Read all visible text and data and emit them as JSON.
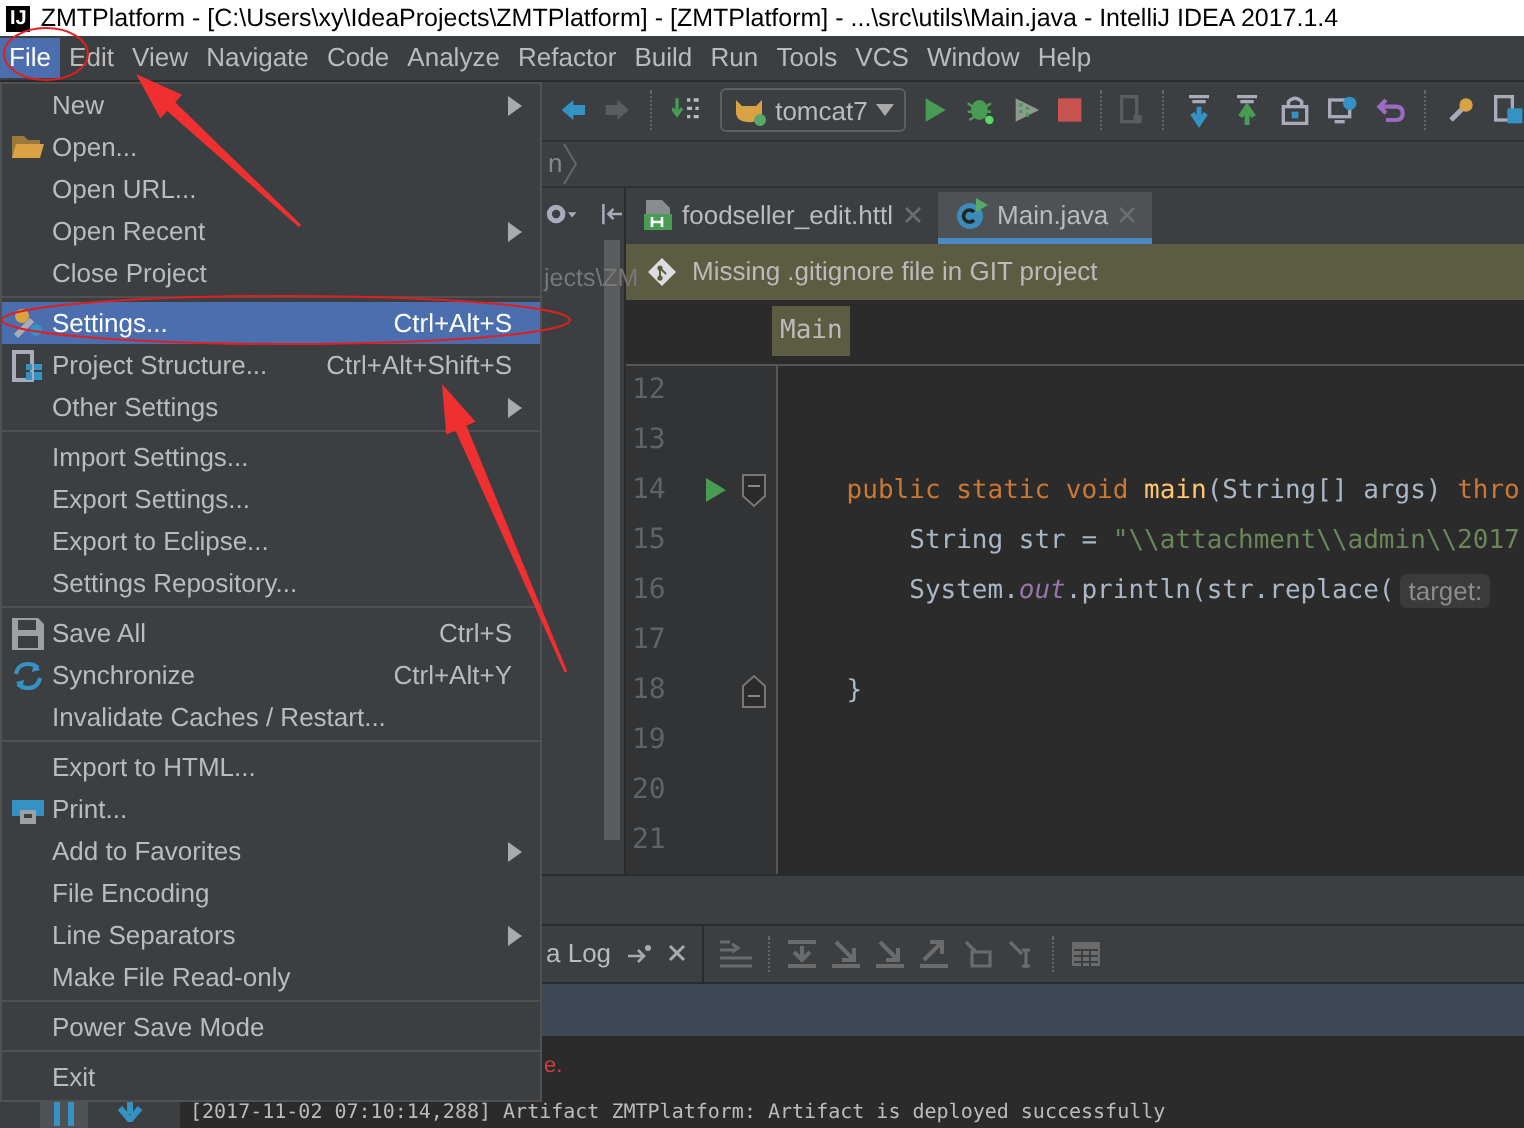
{
  "window": {
    "app_icon": "IJ",
    "title": "ZMTPlatform - [C:\\Users\\xy\\IdeaProjects\\ZMTPlatform] - [ZMTPlatform] - ...\\src\\utils\\Main.java - IntelliJ IDEA 2017.1.4"
  },
  "menu_bar": [
    {
      "label": "File",
      "selected": true
    },
    {
      "label": "Edit",
      "selected": false
    },
    {
      "label": "View",
      "selected": false
    },
    {
      "label": "Navigate",
      "selected": false
    },
    {
      "label": "Code",
      "selected": false
    },
    {
      "label": "Analyze",
      "selected": false
    },
    {
      "label": "Refactor",
      "selected": false
    },
    {
      "label": "Build",
      "selected": false
    },
    {
      "label": "Run",
      "selected": false
    },
    {
      "label": "Tools",
      "selected": false
    },
    {
      "label": "VCS",
      "selected": false
    },
    {
      "label": "Window",
      "selected": false
    },
    {
      "label": "Help",
      "selected": false
    }
  ],
  "file_menu": {
    "sections": [
      {
        "items": [
          {
            "label": "New",
            "submenu": true,
            "selected": false
          },
          {
            "label": "Open...",
            "submenu": false,
            "selected": false
          },
          {
            "label": "Open URL...",
            "submenu": false,
            "selected": false
          },
          {
            "label": "Open Recent",
            "submenu": true,
            "selected": false
          },
          {
            "label": "Close Project",
            "submenu": false,
            "selected": false
          }
        ]
      },
      {
        "items": [
          {
            "label": "Settings...",
            "shortcut": "Ctrl+Alt+S",
            "submenu": false,
            "selected": true
          },
          {
            "label": "Project Structure...",
            "shortcut": "Ctrl+Alt+Shift+S",
            "submenu": false,
            "selected": false
          },
          {
            "label": "Other Settings",
            "submenu": true,
            "selected": false
          }
        ]
      },
      {
        "items": [
          {
            "label": "Import Settings...",
            "submenu": false,
            "selected": false
          },
          {
            "label": "Export Settings...",
            "submenu": false,
            "selected": false
          },
          {
            "label": "Export to Eclipse...",
            "submenu": false,
            "selected": false
          },
          {
            "label": "Settings Repository...",
            "submenu": false,
            "selected": false
          }
        ]
      },
      {
        "items": [
          {
            "label": "Save All",
            "shortcut": "Ctrl+S",
            "submenu": false,
            "selected": false
          },
          {
            "label": "Synchronize",
            "shortcut": "Ctrl+Alt+Y",
            "submenu": false,
            "selected": false
          },
          {
            "label": "Invalidate Caches / Restart...",
            "submenu": false,
            "selected": false
          }
        ]
      },
      {
        "items": [
          {
            "label": "Export to HTML...",
            "submenu": false,
            "selected": false
          },
          {
            "label": "Print...",
            "submenu": false,
            "selected": false
          },
          {
            "label": "Add to Favorites",
            "submenu": true,
            "selected": false
          },
          {
            "label": "File Encoding",
            "submenu": false,
            "selected": false
          },
          {
            "label": "Line Separators",
            "submenu": true,
            "selected": false
          },
          {
            "label": "Make File Read-only",
            "submenu": false,
            "selected": false
          }
        ]
      },
      {
        "items": [
          {
            "label": "Power Save Mode",
            "submenu": false,
            "selected": false
          }
        ]
      },
      {
        "items": [
          {
            "label": "Exit",
            "submenu": false,
            "selected": false
          }
        ]
      }
    ]
  },
  "toolbar": {
    "run_configuration": "tomcat7"
  },
  "navigation_bar": {
    "crumb": "n"
  },
  "project_panel": {
    "path": "jects\\ZM"
  },
  "editor": {
    "tabs": [
      {
        "label": "foodseller_edit.httl",
        "selected": false
      },
      {
        "label": "Main.java",
        "selected": true
      }
    ],
    "notification": "Missing .gitignore file in GIT project",
    "breadcrumb": "Main",
    "lines": [
      {
        "number": "12"
      },
      {
        "number": "13"
      },
      {
        "number": "14",
        "run_marker": true,
        "fold_start": true,
        "segments": [
          {
            "kind": "keyword",
            "text": "    public static void "
          },
          {
            "kind": "method",
            "text": "main"
          },
          {
            "kind": "plain",
            "text": "(String[] args) "
          },
          {
            "kind": "keyword",
            "text": "thro"
          }
        ]
      },
      {
        "number": "15",
        "segments": [
          {
            "kind": "plain",
            "text": "        String str = "
          },
          {
            "kind": "string",
            "text": "\"\\\\attachment\\\\admin\\\\2017"
          }
        ]
      },
      {
        "number": "16",
        "segments": [
          {
            "kind": "plain",
            "text": "        System."
          },
          {
            "kind": "field",
            "text": "out"
          },
          {
            "kind": "plain",
            "text": ".println(str.replace("
          },
          {
            "kind": "hint",
            "text": "target:"
          }
        ]
      },
      {
        "number": "17"
      },
      {
        "number": "18",
        "fold_end": true,
        "segments": [
          {
            "kind": "plain",
            "text": "    }"
          }
        ]
      },
      {
        "number": "19"
      },
      {
        "number": "20"
      },
      {
        "number": "21"
      }
    ]
  },
  "bottom_panel": {
    "tab": "a Log",
    "error_fragment": "e.",
    "log_line": "[2017-11-02 07:10:14,288] Artifact ZMTPlatform: Artifact is deployed successfully"
  }
}
